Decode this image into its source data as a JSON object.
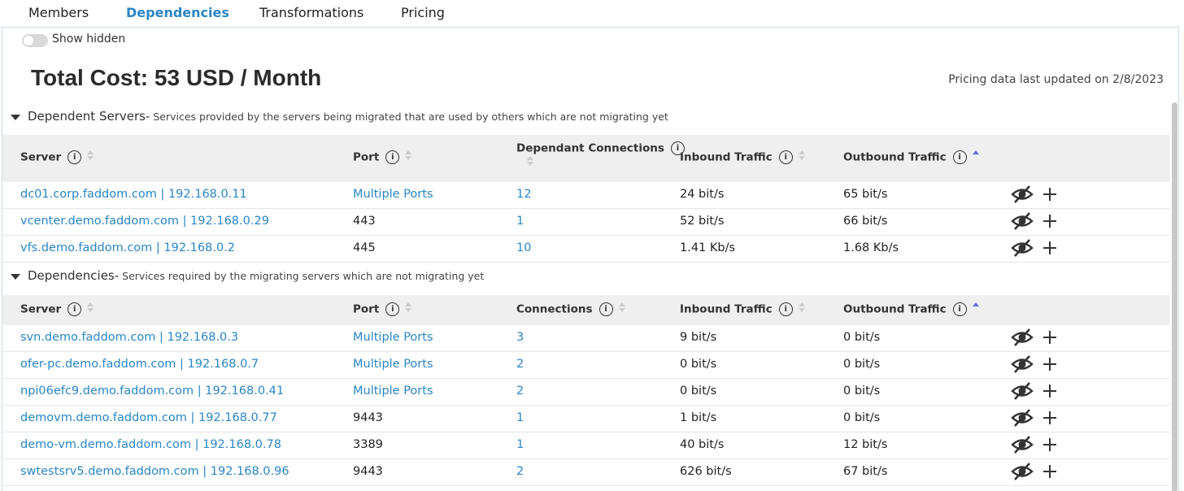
{
  "tabs": [
    "Members",
    "Dependencies",
    "Transformations",
    "Pricing"
  ],
  "show_hidden_label": "Show hidden",
  "total_cost": "Total Cost: 53 USD / Month",
  "pricing_updated": "Pricing data last updated on 2/8/2023",
  "colors": {
    "accent": "#2a86c6",
    "sort_active": "#6b6bdb",
    "header_bg": "#efefef"
  },
  "icons": {
    "hide": "eye-slash-icon",
    "add": "plus-icon",
    "info": "info-icon",
    "collapse": "caret-down-icon"
  },
  "dependent_servers": {
    "title": "Dependent Servers-",
    "description": "Services provided by the servers being migrated that are used by others which are not migrating yet",
    "columns": [
      "Server",
      "Port",
      "Dependant Connections",
      "Inbound Traffic",
      "Outbound Traffic"
    ],
    "rows": [
      [
        "dc01.corp.faddom.com | 192.168.0.11",
        "Multiple Ports",
        "12",
        "24 bit/s",
        "65 bit/s"
      ],
      [
        "vcenter.demo.faddom.com | 192.168.0.29",
        "443",
        "1",
        "52 bit/s",
        "66 bit/s"
      ],
      [
        "vfs.demo.faddom.com | 192.168.0.2",
        "445",
        "10",
        "1.41 Kb/s",
        "1.68 Kb/s"
      ]
    ]
  },
  "dependencies": {
    "title": "Dependencies-",
    "description": "Services required by the migrating servers which are not migrating yet",
    "columns": [
      "Server",
      "Port",
      "Connections",
      "Inbound Traffic",
      "Outbound Traffic"
    ],
    "rows": [
      [
        "svn.demo.faddom.com | 192.168.0.3",
        "Multiple Ports",
        "3",
        "9 bit/s",
        "0 bit/s"
      ],
      [
        "ofer-pc.demo.faddom.com | 192.168.0.7",
        "Multiple Ports",
        "2",
        "0 bit/s",
        "0 bit/s"
      ],
      [
        "npi06efc9.demo.faddom.com | 192.168.0.41",
        "Multiple Ports",
        "2",
        "0 bit/s",
        "0 bit/s"
      ],
      [
        "demovm.demo.faddom.com | 192.168.0.77",
        "9443",
        "1",
        "1 bit/s",
        "0 bit/s"
      ],
      [
        "demo-vm.demo.faddom.com | 192.168.0.78",
        "3389",
        "1",
        "40 bit/s",
        "12 bit/s"
      ],
      [
        "swtestsrv5.demo.faddom.com | 192.168.0.96",
        "9443",
        "2",
        "626 bit/s",
        "67 bit/s"
      ]
    ]
  }
}
